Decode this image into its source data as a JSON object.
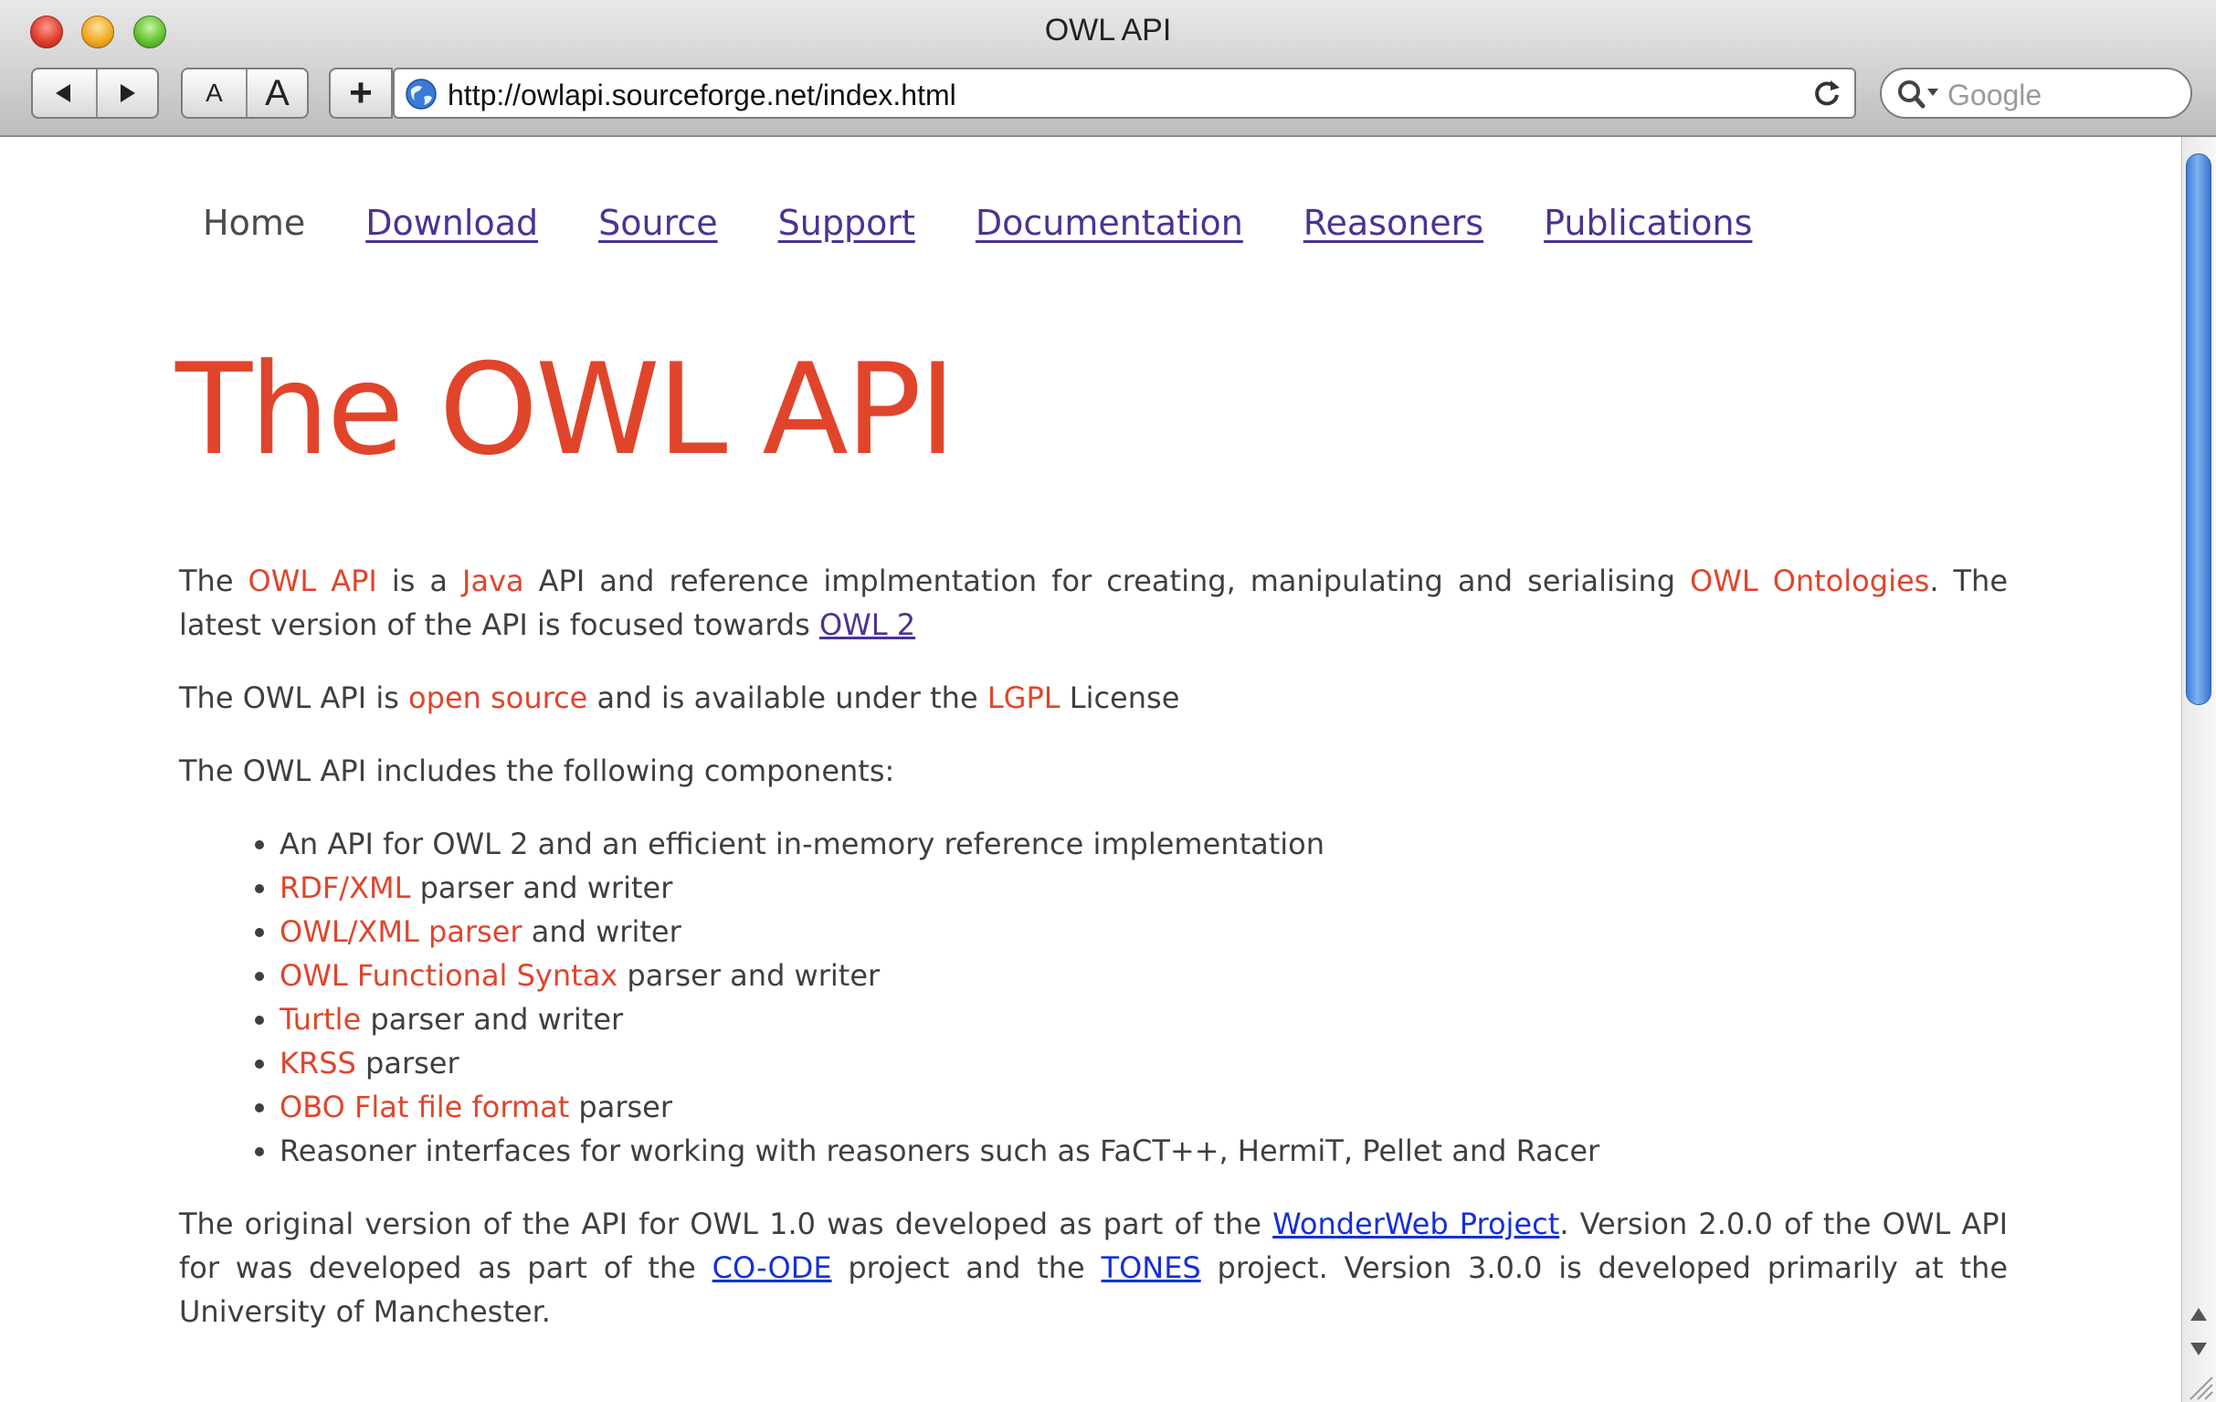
{
  "window": {
    "title": "OWL API"
  },
  "toolbar": {
    "back_icon": "back-arrow-icon",
    "forward_icon": "forward-arrow-icon",
    "text_smaller_label": "A",
    "text_bigger_label": "A",
    "add_bookmark_label": "+",
    "url": "http://owlapi.sourceforge.net/index.html",
    "search_placeholder": "Google"
  },
  "nav": {
    "items": [
      {
        "label": "Home"
      },
      {
        "label": "Download"
      },
      {
        "label": "Source"
      },
      {
        "label": "Support"
      },
      {
        "label": "Documentation"
      },
      {
        "label": "Reasoners"
      },
      {
        "label": "Publications"
      }
    ]
  },
  "page": {
    "heading": "The OWL API",
    "p1": {
      "t1": "The ",
      "owl_api": "OWL API",
      "t2": " is a ",
      "java": "Java",
      "t3": " API and reference implmentation for creating, manipulating and serialising ",
      "owl_ontologies": "OWL Ontologies",
      "t4": ". The latest version of the API is focused towards ",
      "owl2": "OWL 2"
    },
    "p2": {
      "t1": "The OWL API is ",
      "open_source": "open source",
      "t2": " and is available under the ",
      "lgpl": "LGPL",
      "t3": " License"
    },
    "p3": "The OWL API includes the following components:",
    "components": {
      "c1": "An API for OWL 2 and an efficient in-memory reference implementation",
      "c2_link": "RDF/XML",
      "c2_text": " parser and writer",
      "c3_link": "OWL/XML parser",
      "c3_text": " and writer",
      "c4_link": "OWL Functional Syntax",
      "c4_text": " parser and writer",
      "c5_link": "Turtle",
      "c5_text": " parser and writer",
      "c6_link": "KRSS",
      "c6_text": " parser",
      "c7_link": "OBO Flat file format",
      "c7_text": " parser",
      "c8": "Reasoner interfaces for working with reasoners such as FaCT++, HermiT, Pellet and Racer"
    },
    "p4": {
      "t1": "The original version of the API for OWL 1.0 was developed as part of the ",
      "wonderweb": "WonderWeb Project",
      "t2": ". Version 2.0.0 of the OWL API for was developed as part of the ",
      "coode": "CO-ODE",
      "t3": " project and the ",
      "tones": "TONES",
      "t4": " project. Version 3.0.0 is developed primarily at the University of Manchester."
    }
  },
  "colors": {
    "accent_red": "#e0452b",
    "visited_link": "#4c3294",
    "link_blue": "#1530d8",
    "body_text": "#3f3f3f"
  }
}
